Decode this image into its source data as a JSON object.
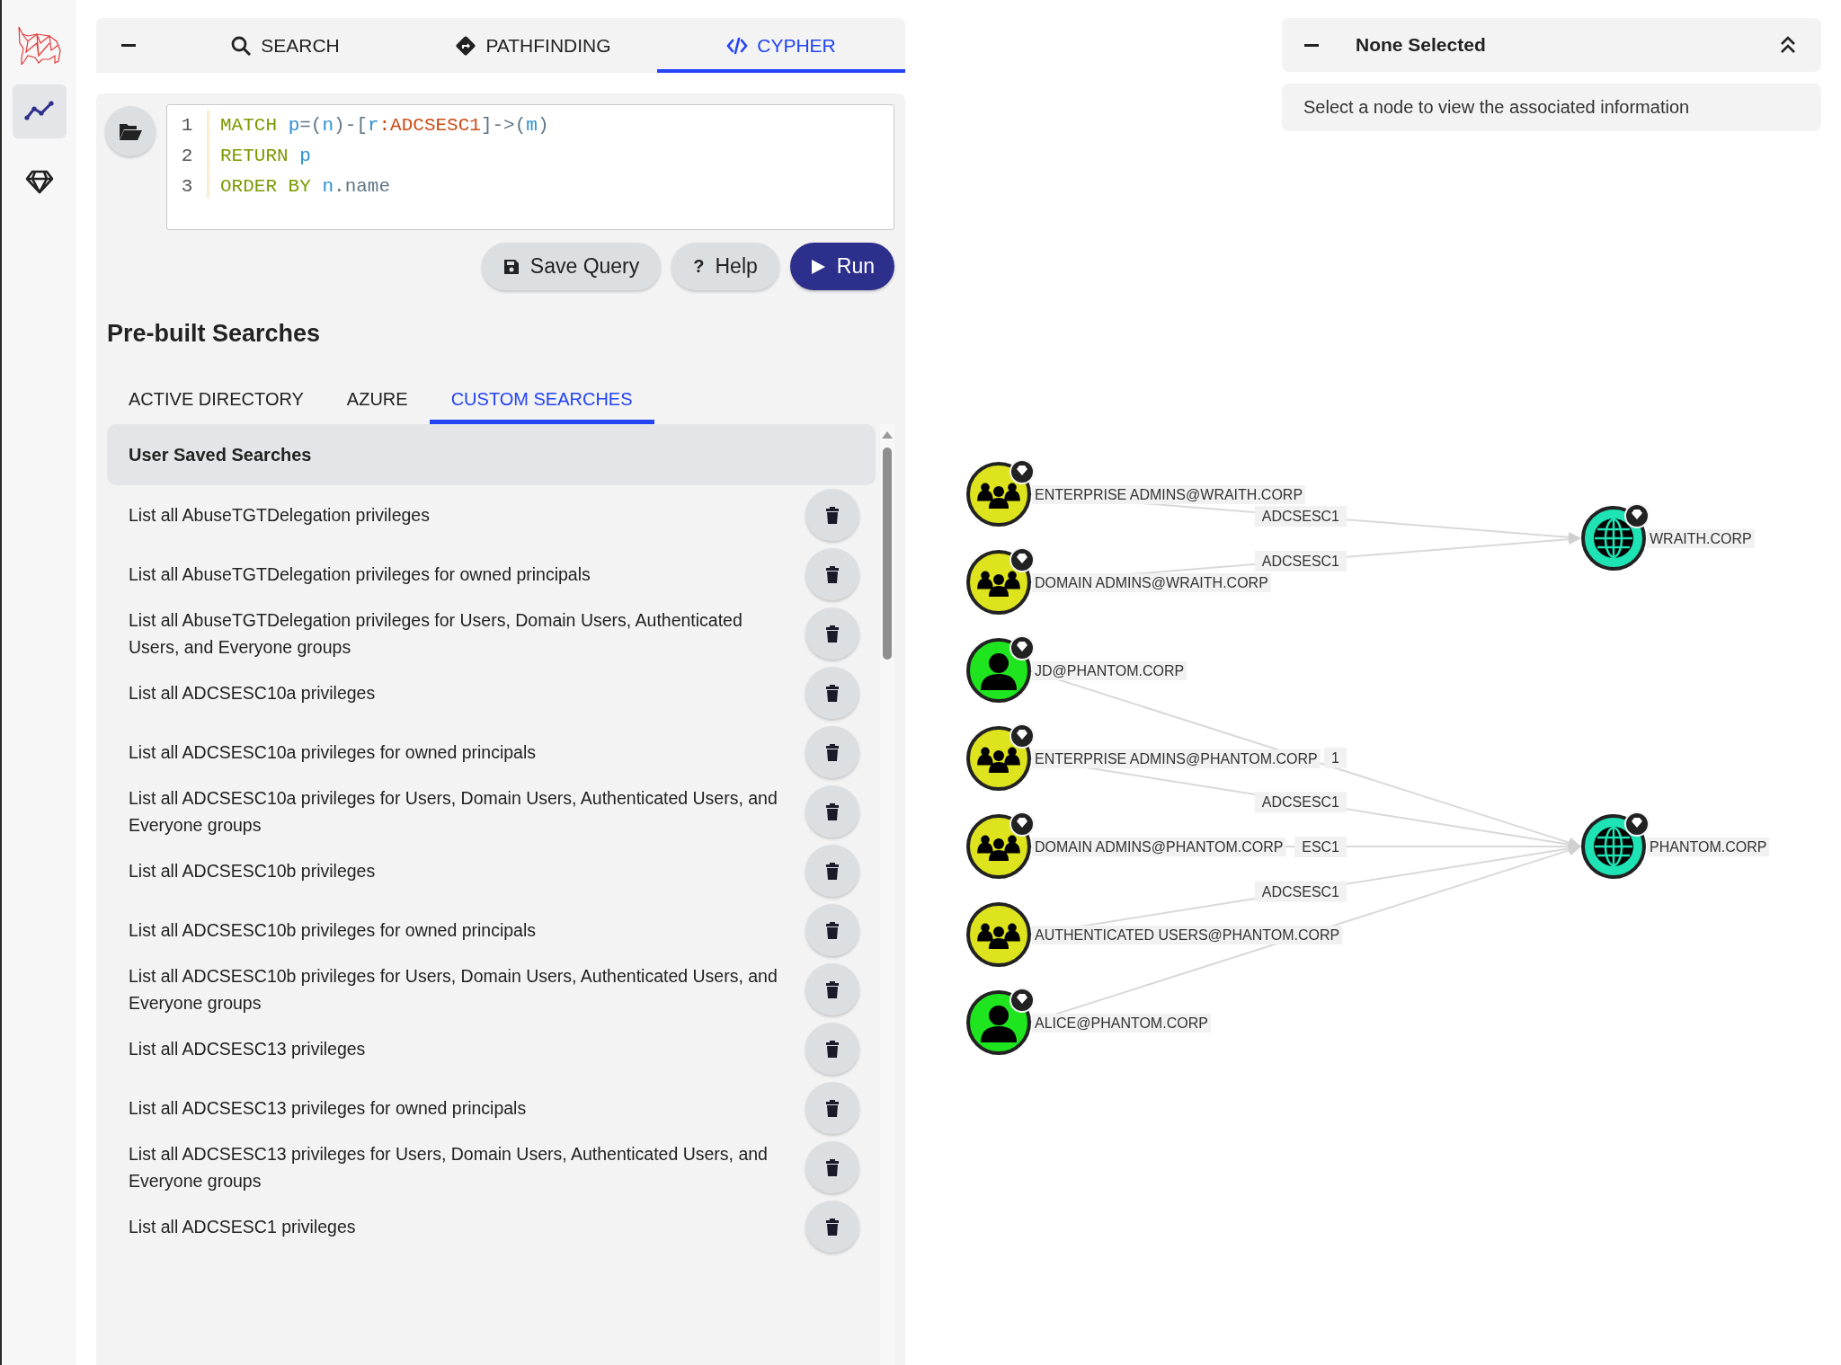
{
  "sidebar": {
    "nav_items": [
      {
        "kind": "graph",
        "selected": true
      },
      {
        "kind": "gem",
        "selected": false
      }
    ]
  },
  "top_tabs": [
    {
      "label": "SEARCH",
      "kind": "search",
      "selected": false
    },
    {
      "label": "PATHFINDING",
      "kind": "pathfinding",
      "selected": false
    },
    {
      "label": "CYPHER",
      "kind": "cypher",
      "selected": true
    }
  ],
  "query": {
    "lines": [
      {
        "number": "1",
        "words": [
          [
            {
              "text": "MATCH",
              "kind": "keyword"
            }
          ],
          [
            {
              "text": "p",
              "kind": "variable"
            },
            {
              "text": "=(",
              "kind": "punct"
            },
            {
              "text": "n",
              "kind": "variable"
            },
            {
              "text": ")-[",
              "kind": "punct"
            },
            {
              "text": "r",
              "kind": "variable"
            },
            {
              "text": ":ADCSESC1",
              "kind": "label"
            },
            {
              "text": "]->(",
              "kind": "punct"
            },
            {
              "text": "m",
              "kind": "variable"
            },
            {
              "text": ")",
              "kind": "punct"
            }
          ]
        ]
      },
      {
        "number": "2",
        "words": [
          [
            {
              "text": "RETURN",
              "kind": "keyword"
            }
          ],
          [
            {
              "text": "p",
              "kind": "variable"
            }
          ]
        ]
      },
      {
        "number": "3",
        "words": [
          [
            {
              "text": "ORDER BY",
              "kind": "keyword"
            }
          ],
          [
            {
              "text": "n",
              "kind": "variable"
            },
            {
              "text": ".name",
              "kind": "property"
            }
          ]
        ]
      }
    ]
  },
  "query_buttons": [
    {
      "kind": "save",
      "label": "Save Query"
    },
    {
      "kind": "help",
      "glyph": "?",
      "label": "Help"
    },
    {
      "kind": "run",
      "label": "Run"
    }
  ],
  "prebuilt": {
    "title": "Pre-built Searches",
    "tabs": [
      {
        "label": "ACTIVE DIRECTORY",
        "selected": false
      },
      {
        "label": "AZURE",
        "selected": false
      },
      {
        "label": "CUSTOM SEARCHES",
        "selected": true
      }
    ],
    "section_title": "User Saved Searches",
    "items": [
      "List all AbuseTGTDelegation privileges",
      "List all AbuseTGTDelegation privileges for owned principals",
      "List all AbuseTGTDelegation privileges for Users, Domain Users, Authenticated Users, and Everyone groups",
      "List all ADCSESC10a privileges",
      "List all ADCSESC10a privileges for owned principals",
      "List all ADCSESC10a privileges for Users, Domain Users, Authenticated Users, and Everyone groups",
      "List all ADCSESC10b privileges",
      "List all ADCSESC10b privileges for owned principals",
      "List all ADCSESC10b privileges for Users, Domain Users, Authenticated Users, and Everyone groups",
      "List all ADCSESC13 privileges",
      "List all ADCSESC13 privileges for owned principals",
      "List all ADCSESC13 privileges for Users, Domain Users, Authenticated Users, and Everyone groups",
      "List all ADCSESC1 privileges"
    ]
  },
  "info_panel": {
    "title": "None Selected",
    "message": "Select a node to view the associated information"
  },
  "graph": {
    "targets": [
      {
        "name": "WRAITH.CORP",
        "kind": "domain",
        "high_value": true,
        "sources": [
          {
            "name": "ENTERPRISE ADMINS@WRAITH.CORP",
            "kind": "group",
            "high_value": true,
            "edge_label": "ADCSESC1"
          },
          {
            "name": "DOMAIN ADMINS@WRAITH.CORP",
            "kind": "group",
            "high_value": true,
            "edge_label": "ADCSESC1"
          }
        ]
      },
      {
        "name": "PHANTOM.CORP",
        "kind": "domain",
        "high_value": true,
        "sources": [
          {
            "name": "JD@PHANTOM.CORP",
            "kind": "user",
            "high_value": true,
            "edge_label": "1"
          },
          {
            "name": "ENTERPRISE ADMINS@PHANTOM.CORP",
            "kind": "group",
            "high_value": true,
            "edge_label": "ADCSESC1"
          },
          {
            "name": "DOMAIN ADMINS@PHANTOM.CORP",
            "kind": "group",
            "high_value": true,
            "edge_label": "ESC1"
          },
          {
            "name": "AUTHENTICATED USERS@PHANTOM.CORP",
            "kind": "group",
            "high_value": false,
            "edge_label": "ADCSESC1"
          },
          {
            "name": "ALICE@PHANTOM.CORP",
            "kind": "user",
            "high_value": true
          }
        ]
      }
    ]
  }
}
